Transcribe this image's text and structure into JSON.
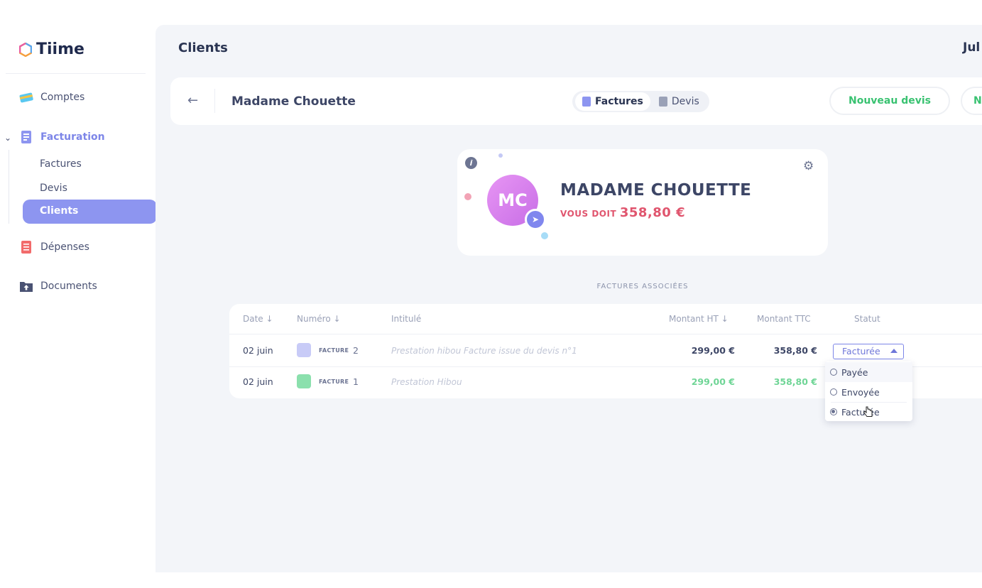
{
  "app": {
    "name": "Tiime"
  },
  "sidebar": {
    "items": [
      {
        "label": "Comptes",
        "icon": "card-icon"
      },
      {
        "label": "Facturation",
        "icon": "invoice-icon"
      },
      {
        "label": "Dépenses",
        "icon": "receipt-icon"
      },
      {
        "label": "Documents",
        "icon": "folder-upload-icon"
      }
    ],
    "subitems": [
      {
        "label": "Factures"
      },
      {
        "label": "Devis"
      },
      {
        "label": "Clients"
      }
    ]
  },
  "header": {
    "page_title": "Clients",
    "user_partial": "Jul",
    "client_name": "Madame Chouette",
    "tabs": [
      {
        "label": "Factures",
        "active": true
      },
      {
        "label": "Devis",
        "active": false
      }
    ],
    "new_quote_label": "Nouveau devis",
    "new_partial_label": "N"
  },
  "profile": {
    "initials": "MC",
    "name": "MADAME CHOUETTE",
    "owes_label": "VOUS DOIT",
    "owes_amount": "358,80 €"
  },
  "invoices": {
    "section_title": "FACTURES ASSOCIÉES",
    "columns": [
      "Date ↓",
      "Numéro ↓",
      "Intitulé",
      "Montant HT ↓",
      "Montant TTC",
      "Statut"
    ],
    "rows": [
      {
        "date": "02 juin",
        "type": "FACTURE",
        "number": "2",
        "title": "Prestation hibou Facture issue du devis n°1",
        "ht": "299,00 €",
        "ttc": "358,80 €",
        "status": "Facturée"
      },
      {
        "date": "02 juin",
        "type": "FACTURE",
        "number": "1",
        "title": "Prestation Hibou",
        "ht": "299,00 €",
        "ttc": "358,80 €",
        "status": ""
      }
    ]
  },
  "status_dropdown": {
    "options": [
      {
        "label": "Payée",
        "selected": false
      },
      {
        "label": "Envoyée",
        "selected": false
      },
      {
        "label": "Facturée",
        "selected": true
      }
    ]
  },
  "colors": {
    "accent": "#8d95f0",
    "success": "#39c271",
    "danger": "#e0556e",
    "text": "#3d4666"
  }
}
